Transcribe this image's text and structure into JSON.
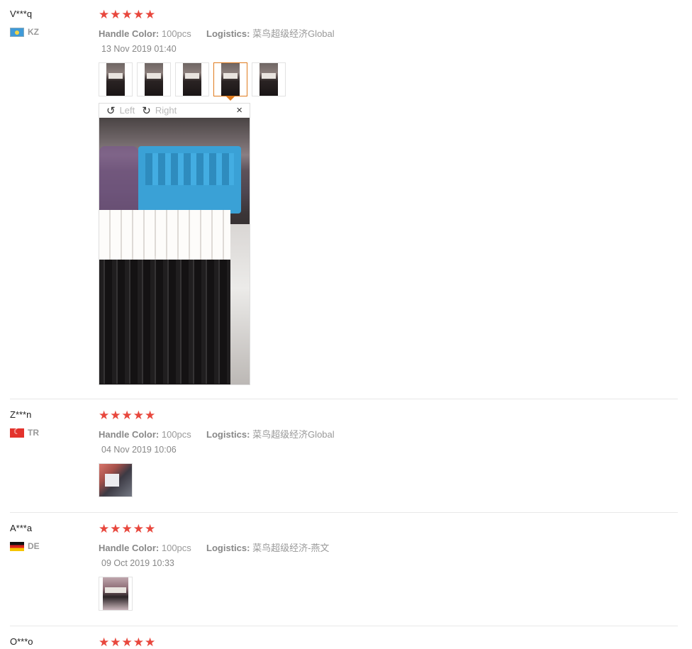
{
  "reviews": [
    {
      "user": "V***q",
      "country": "KZ",
      "stars": "★★★★★",
      "color_label": "Handle Color:",
      "color_value": "100pcs",
      "logistics_label": "Logistics:",
      "logistics_value": "菜鸟超级经济Global",
      "date": "13 Nov 2019 01:40",
      "thumbnail_count": 5,
      "active_thumbnail": 4
    },
    {
      "user": "Z***n",
      "country": "TR",
      "stars": "★★★★★",
      "color_label": "Handle Color:",
      "color_value": "100pcs",
      "logistics_label": "Logistics:",
      "logistics_value": "菜鸟超级经济Global",
      "date": "04 Nov 2019 10:06",
      "thumbnail_count": 1
    },
    {
      "user": "A***a",
      "country": "DE",
      "stars": "★★★★★",
      "color_label": "Handle Color:",
      "color_value": "100pcs",
      "logistics_label": "Logistics:",
      "logistics_value": "菜鸟超级经济-燕文",
      "date": "09 Oct 2019 10:33",
      "thumbnail_count": 1
    },
    {
      "user": "O***o",
      "stars": "★★★★★"
    }
  ],
  "viewer": {
    "rotate_left_icon": "↺",
    "rotate_left_label": "Left",
    "rotate_right_icon": "↻",
    "rotate_right_label": "Right",
    "close_icon": "×"
  },
  "colors": {
    "star": "#e8473d",
    "active_border": "#e07b1e"
  }
}
